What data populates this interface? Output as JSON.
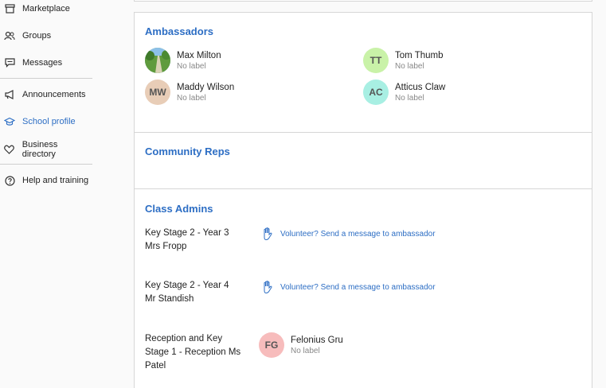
{
  "sidebar": {
    "items": [
      {
        "label": "Marketplace",
        "icon": "store-icon"
      },
      {
        "label": "Groups",
        "icon": "groups-icon"
      },
      {
        "label": "Messages",
        "icon": "messages-icon"
      },
      {
        "label": "Announcements",
        "icon": "megaphone-icon"
      },
      {
        "label": "School profile",
        "icon": "graduation-cap-icon",
        "active": true
      },
      {
        "label": "Business directory",
        "icon": "heart-icon"
      },
      {
        "label": "Help and training",
        "icon": "help-icon"
      }
    ]
  },
  "sections": {
    "ambassadors": {
      "title": "Ambassadors",
      "people": [
        {
          "name": "Max Milton",
          "label": "No label",
          "avatar": "photo"
        },
        {
          "name": "Tom Thumb",
          "label": "No label",
          "initials": "TT",
          "color": "#c9f2a8"
        },
        {
          "name": "Maddy Wilson",
          "label": "No label",
          "initials": "MW",
          "color": "#e8cdb7"
        },
        {
          "name": "Atticus Claw",
          "label": "No label",
          "initials": "AC",
          "color": "#a8efe3"
        }
      ]
    },
    "community_reps": {
      "title": "Community Reps"
    },
    "class_admins": {
      "title": "Class Admins",
      "classes": [
        {
          "line1": "Key Stage 2 - Year 3",
          "line2": "Mrs Fropp",
          "volunteer": "Volunteer? Send a message to ambassador"
        },
        {
          "line1": "Key Stage 2 - Year 4",
          "line2": "Mr Standish",
          "volunteer": "Volunteer? Send a message to ambassador"
        },
        {
          "line1": "Reception and Key",
          "line2": "Stage 1 - Reception Ms",
          "line3": "Patel",
          "admin": {
            "name": "Felonius Gru",
            "label": "No label",
            "initials": "FG",
            "color": "#f7bcbc"
          }
        }
      ]
    }
  },
  "colors": {
    "accent": "#2d6ec4",
    "border": "#d6d6d6"
  }
}
